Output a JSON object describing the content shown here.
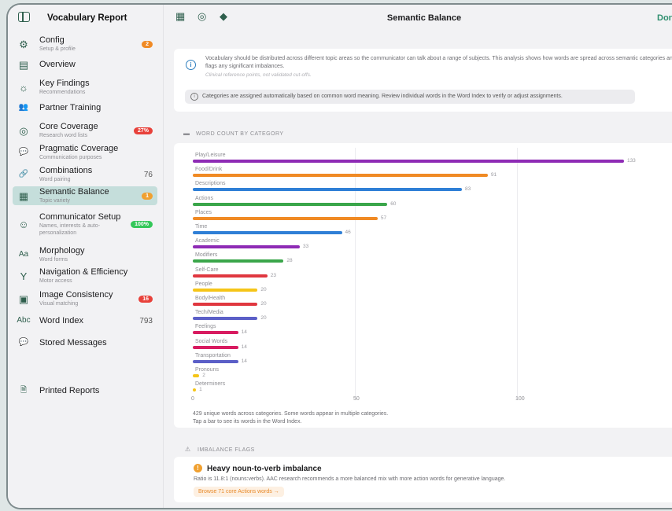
{
  "sidebar": {
    "title": "Vocabulary Report",
    "items": [
      {
        "label": "Config",
        "sub": "Setup & profile",
        "badge": "2",
        "badge_color": "#f08a24",
        "icon": "gear-icon",
        "glyph": "⚙"
      },
      {
        "label": "Overview",
        "sub": "",
        "icon": "document-icon",
        "glyph": "▤"
      },
      {
        "label": "Key Findings",
        "sub": "Recommendations",
        "icon": "lightbulb-icon",
        "glyph": "☼"
      },
      {
        "label": "Partner Training",
        "sub": "",
        "icon": "people-icon",
        "glyph": "👥"
      },
      {
        "label": "Core Coverage",
        "sub": "Research word lists",
        "badge": "27%",
        "badge_color": "#e8413a",
        "icon": "target-icon",
        "glyph": "◎"
      },
      {
        "label": "Pragmatic Coverage",
        "sub": "Communication purposes",
        "icon": "chat-bubbles-icon",
        "glyph": "💬"
      },
      {
        "label": "Combinations",
        "sub": "Word pairing",
        "count": "76",
        "icon": "link-icon",
        "glyph": "🔗"
      },
      {
        "label": "Semantic Balance",
        "sub": "Topic variety",
        "badge": "1",
        "badge_color": "#f0a030",
        "icon": "grid-icon",
        "glyph": "▦",
        "active": true
      },
      {
        "label": "Communicator Setup",
        "sub": "Names, interests & auto-personalization",
        "badge": "100%",
        "badge_color": "#34c759",
        "icon": "person-circle-icon",
        "glyph": "☺"
      },
      {
        "label": "Morphology",
        "sub": "Word forms",
        "icon": "text-aa-icon",
        "glyph": "Aa"
      },
      {
        "label": "Navigation & Efficiency",
        "sub": "Motor access",
        "icon": "branch-icon",
        "glyph": "Y"
      },
      {
        "label": "Image Consistency",
        "sub": "Visual matching",
        "badge": "16",
        "badge_color": "#e8413a",
        "icon": "photo-icon",
        "glyph": "▣"
      },
      {
        "label": "Word Index",
        "sub": "",
        "count": "793",
        "icon": "abc-icon",
        "glyph": "Abc"
      },
      {
        "label": "Stored Messages",
        "sub": "",
        "icon": "message-icon",
        "glyph": "💬"
      },
      {
        "label": "Printed Reports",
        "sub": "",
        "icon": "report-icon",
        "glyph": "🗎"
      }
    ]
  },
  "topbar": {
    "title": "Semantic Balance",
    "done_label": "Don",
    "icons": [
      "calendar-icon",
      "target-icon",
      "tag-icon"
    ]
  },
  "info": {
    "text": "Vocabulary should be distributed across different topic areas so the communicator can talk about a range of subjects. This analysis shows how words are spread across semantic categories and flags any significant imbalances.",
    "note": "Clinical reference points, not validated cut-offs.",
    "notice": "Categories are assigned automatically based on common word meaning. Review individual words in the Word Index to verify or adjust assignments."
  },
  "chart_section": {
    "title": "WORD COUNT BY CATEGORY",
    "footer1": "429 unique words across categories. Some words appear in multiple categories.",
    "footer2": "Tap a bar to see its words in the Word Index."
  },
  "chart_data": {
    "type": "bar",
    "orientation": "horizontal",
    "categories": [
      "Play/Leisure",
      "Food/Drink",
      "Descriptions",
      "Actions",
      "Places",
      "Time",
      "Academic",
      "Modifiers",
      "Self-Care",
      "People",
      "Body/Health",
      "Tech/Media",
      "Feelings",
      "Social Words",
      "Transportation",
      "Pronouns",
      "Determiners"
    ],
    "values": [
      133,
      91,
      83,
      60,
      57,
      46,
      33,
      28,
      23,
      20,
      20,
      20,
      14,
      14,
      14,
      2,
      1
    ],
    "colors": [
      "#8e2bb5",
      "#f08a24",
      "#2f7fd6",
      "#3aa64a",
      "#f08a24",
      "#2f7fd6",
      "#8e2bb5",
      "#3aa64a",
      "#e0373f",
      "#f5c518",
      "#e0373f",
      "#5b5fc7",
      "#d81b60",
      "#d81b60",
      "#5b5fc7",
      "#f5c518",
      "#f5c518"
    ],
    "xticks": [
      "0",
      "50",
      "100"
    ],
    "xlim": [
      0,
      150
    ],
    "grid": true
  },
  "flags_section": {
    "title": "IMBALANCE FLAGS",
    "flag_title": "Heavy noun-to-verb imbalance",
    "flag_desc": "Ratio is 11.8:1 (nouns:verbs). AAC research recommends a more balanced mix with more action words for generative language.",
    "flag_button": "Browse 71 core Actions words →"
  }
}
